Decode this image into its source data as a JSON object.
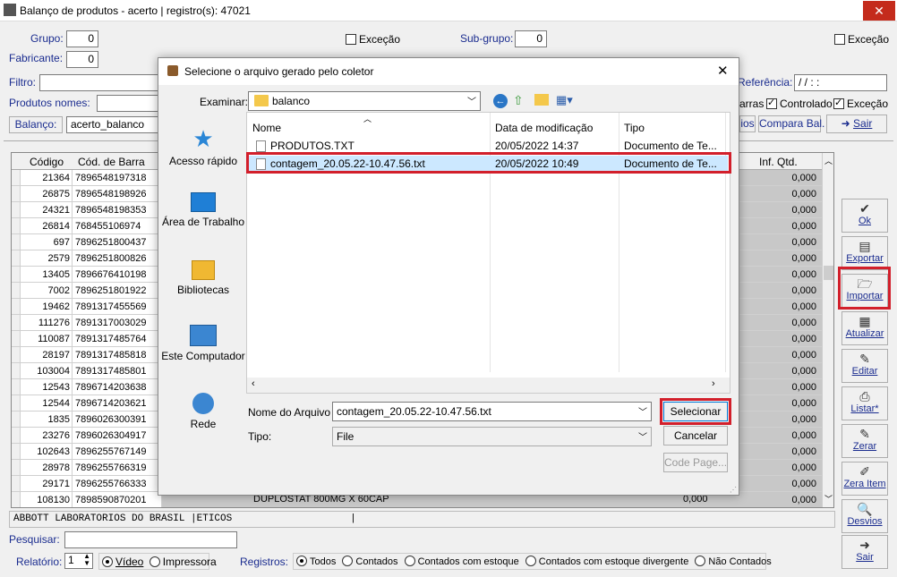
{
  "window": {
    "title": "Balanço de produtos - acerto | registro(s): 47021"
  },
  "filters": {
    "grupo_label": "Grupo:",
    "grupo_value": "0",
    "fabricante_label": "Fabricante:",
    "fabricante_value": "0",
    "excecao1_label": "Exceção",
    "subgrupo_label": "Sub-grupo:",
    "subgrupo_value": "0",
    "excecao2_label": "Exceção",
    "filtro_label": "Filtro:",
    "produtos_nomes_label": "Produtos nomes:",
    "balanco_btn": "Balanço:",
    "balanco_value": "acerto_balanco",
    "referencia_label": "Referência:",
    "referencia_value": "/ /     : :",
    "controlado_label": "Controlado",
    "excecao3_label": "Exceção",
    "barras_label": "arras",
    "compara_btn": "Compara Bal.",
    "sair_top_btn": "Sair",
    "rios_btn": "ios"
  },
  "grid": {
    "col_codigo": "Código",
    "col_barra": "Cód. de Barra",
    "col_infqtd": "Inf. Qtd.",
    "rows": [
      {
        "codigo": "21364",
        "barra": "7896548197318",
        "qtd": "0,000"
      },
      {
        "codigo": "26875",
        "barra": "7896548198926",
        "qtd": "0,000"
      },
      {
        "codigo": "24321",
        "barra": "7896548198353",
        "qtd": "0,000"
      },
      {
        "codigo": "26814",
        "barra": "768455106974",
        "qtd": "0,000"
      },
      {
        "codigo": "697",
        "barra": "7896251800437",
        "qtd": "0,000"
      },
      {
        "codigo": "2579",
        "barra": "7896251800826",
        "qtd": "0,000"
      },
      {
        "codigo": "13405",
        "barra": "7896676410198",
        "qtd": "0,000"
      },
      {
        "codigo": "7002",
        "barra": "7896251801922",
        "qtd": "0,000"
      },
      {
        "codigo": "19462",
        "barra": "7891317455569",
        "qtd": "0,000"
      },
      {
        "codigo": "111276",
        "barra": "7891317003029",
        "qtd": "0,000"
      },
      {
        "codigo": "110087",
        "barra": "7891317485764",
        "qtd": "0,000"
      },
      {
        "codigo": "28197",
        "barra": "7891317485818",
        "qtd": "0,000"
      },
      {
        "codigo": "103004",
        "barra": "7891317485801",
        "qtd": "0,000"
      },
      {
        "codigo": "12543",
        "barra": "7896714203638",
        "qtd": "0,000"
      },
      {
        "codigo": "12544",
        "barra": "7896714203621",
        "qtd": "0,000"
      },
      {
        "codigo": "1835",
        "barra": "7896026300391",
        "qtd": "0,000"
      },
      {
        "codigo": "23276",
        "barra": "7896026304917",
        "qtd": "0,000"
      },
      {
        "codigo": "102643",
        "barra": "7896255767149",
        "qtd": "0,000"
      },
      {
        "codigo": "28978",
        "barra": "7896255766319",
        "qtd": "0,000"
      },
      {
        "codigo": "29171",
        "barra": "7896255766333",
        "qtd": "0,000"
      },
      {
        "codigo": "108130",
        "barra": "7898590870201",
        "qtd": "0,000"
      }
    ],
    "last_row_desc": "DUPLOSTAT 800MG X 60CAP",
    "last_row_mid": "0,000"
  },
  "status_line": "ABBOTT LABORATORIOS DO BRASIL |ETICOS                    |",
  "bottom": {
    "pesquisar_label": "Pesquisar:",
    "relatorio_label": "Relatório:",
    "relatorio_value": "1",
    "video_label": "Vídeo",
    "impressora_label": "Impressora",
    "registros_label": "Registros:",
    "todos": "Todos",
    "contados": "Contados",
    "contados_estoque": "Contados com estoque",
    "contados_divergente": "Contados com estoque divergente",
    "nao_contados": "Não Contados"
  },
  "side_buttons": [
    "Ok",
    "Exportar",
    "Importar",
    "Atualizar",
    "Editar",
    "Listar*",
    "Zerar",
    "Zera Item",
    "Desvios",
    "Sair"
  ],
  "dialog": {
    "title": "Selecione o arquivo gerado pelo coletor",
    "examinar_label": "Examinar:",
    "folder": "balanco",
    "places": [
      "Acesso rápido",
      "Área de Trabalho",
      "Bibliotecas",
      "Este Computador",
      "Rede"
    ],
    "col_nome": "Nome",
    "col_data": "Data de modificação",
    "col_tipo": "Tipo",
    "files": [
      {
        "nome": "PRODUTOS.TXT",
        "data": "20/05/2022 14:37",
        "tipo": "Documento de Te..."
      },
      {
        "nome": "contagem_20.05.22-10.47.56.txt",
        "data": "20/05/2022 10:49",
        "tipo": "Documento de Te..."
      }
    ],
    "nome_arquivo_label": "Nome do Arquivo",
    "nome_arquivo_value": "contagem_20.05.22-10.47.56.txt",
    "tipo_label": "Tipo:",
    "tipo_value": "File",
    "selecionar_btn": "Selecionar",
    "cancelar_btn": "Cancelar",
    "codepage_btn": "Code Page..."
  },
  "colors": {
    "highlight_red": "#d21f2b",
    "label_blue": "#1a2c8f"
  }
}
